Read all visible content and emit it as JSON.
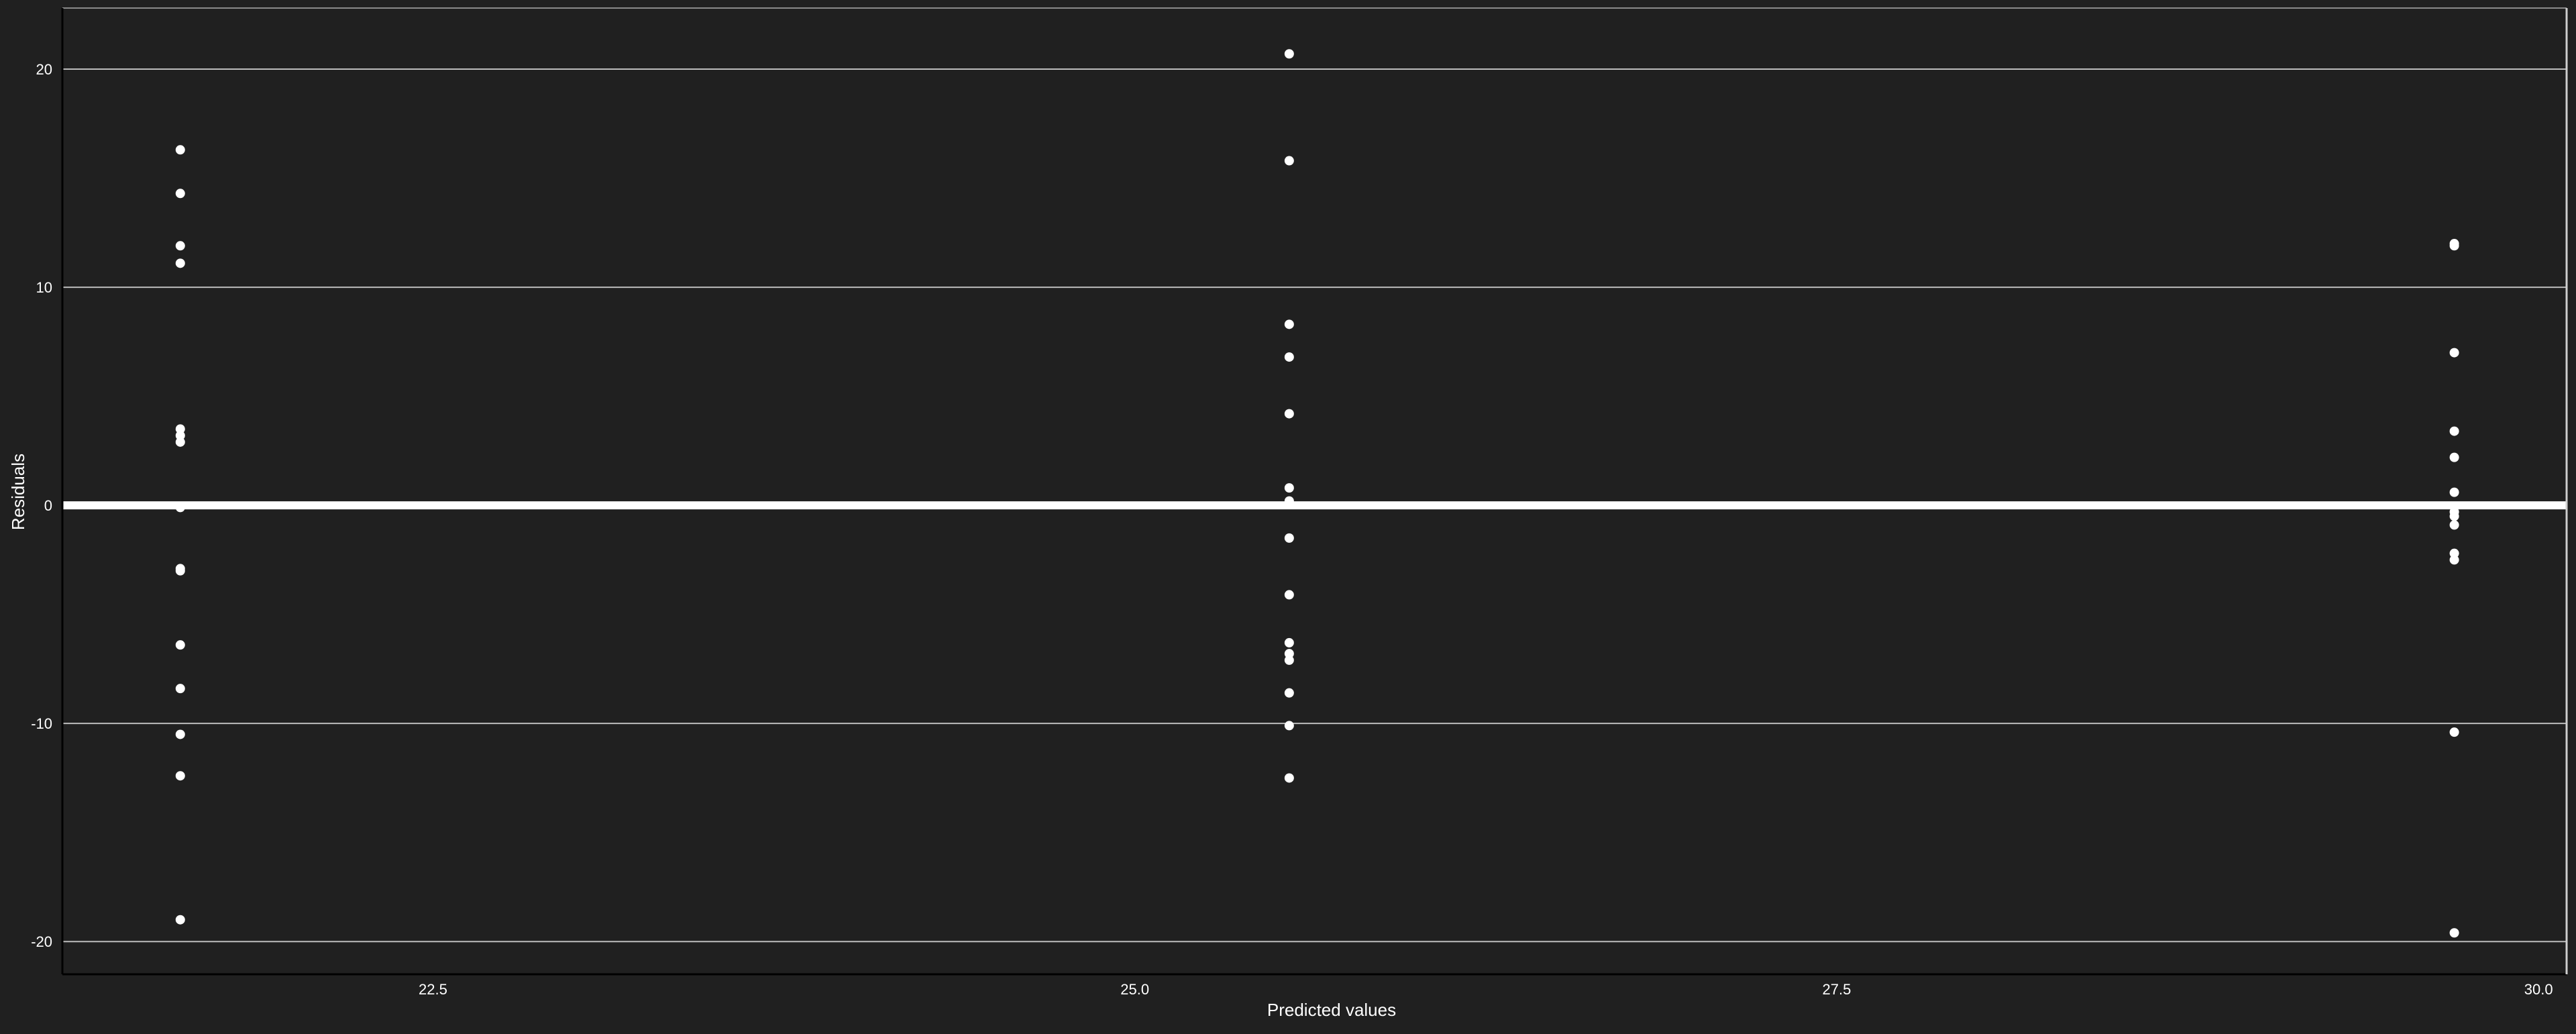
{
  "chart_data": {
    "type": "scatter",
    "title": "",
    "xlabel": "Predicted values",
    "ylabel": "Residuals",
    "xlim": [
      21.18,
      30.1
    ],
    "ylim": [
      -21.5,
      22.8
    ],
    "xticks": [
      22.5,
      25.0,
      27.5,
      30.0
    ],
    "xtick_labels": [
      "22.5",
      "25.0",
      "27.5",
      "30.0"
    ],
    "yticks": [
      -20,
      -10,
      0,
      10,
      20
    ],
    "ytick_labels": [
      "-20",
      "-10",
      "0",
      "10",
      "20"
    ],
    "grid": "horizontal",
    "reference_line_y": 0,
    "colors": {
      "background": "#202020",
      "panel": "#202020",
      "grid": "#bdbdbd",
      "points": "#ffffff",
      "text": "#ffffff",
      "reference_line": "#ffffff"
    },
    "series": [
      {
        "points": [
          [
            21.6,
            16.3
          ],
          [
            21.6,
            14.3
          ],
          [
            21.6,
            11.9
          ],
          [
            21.6,
            11.1
          ],
          [
            21.6,
            3.5
          ],
          [
            21.6,
            3.2
          ],
          [
            21.6,
            2.9
          ],
          [
            21.6,
            -0.1
          ],
          [
            21.6,
            -2.9
          ],
          [
            21.6,
            -3.0
          ],
          [
            21.6,
            -6.4
          ],
          [
            21.6,
            -8.4
          ],
          [
            21.6,
            -10.5
          ],
          [
            21.6,
            -12.4
          ],
          [
            21.6,
            -19.0
          ],
          [
            25.55,
            20.7
          ],
          [
            25.55,
            15.8
          ],
          [
            25.55,
            8.3
          ],
          [
            25.55,
            6.8
          ],
          [
            25.55,
            4.2
          ],
          [
            25.55,
            0.8
          ],
          [
            25.55,
            0.2
          ],
          [
            25.55,
            -1.5
          ],
          [
            25.55,
            -4.1
          ],
          [
            25.55,
            -6.3
          ],
          [
            25.55,
            -6.8
          ],
          [
            25.55,
            -7.1
          ],
          [
            25.55,
            -8.6
          ],
          [
            25.55,
            -10.1
          ],
          [
            25.55,
            -12.5
          ],
          [
            29.7,
            12.0
          ],
          [
            29.7,
            11.9
          ],
          [
            29.7,
            7.0
          ],
          [
            29.7,
            3.4
          ],
          [
            29.7,
            2.2
          ],
          [
            29.7,
            0.6
          ],
          [
            29.7,
            -0.3
          ],
          [
            29.7,
            -0.5
          ],
          [
            29.7,
            -0.9
          ],
          [
            29.7,
            -2.2
          ],
          [
            29.7,
            -2.5
          ],
          [
            29.7,
            -10.4
          ],
          [
            29.7,
            -19.6
          ]
        ]
      }
    ]
  }
}
